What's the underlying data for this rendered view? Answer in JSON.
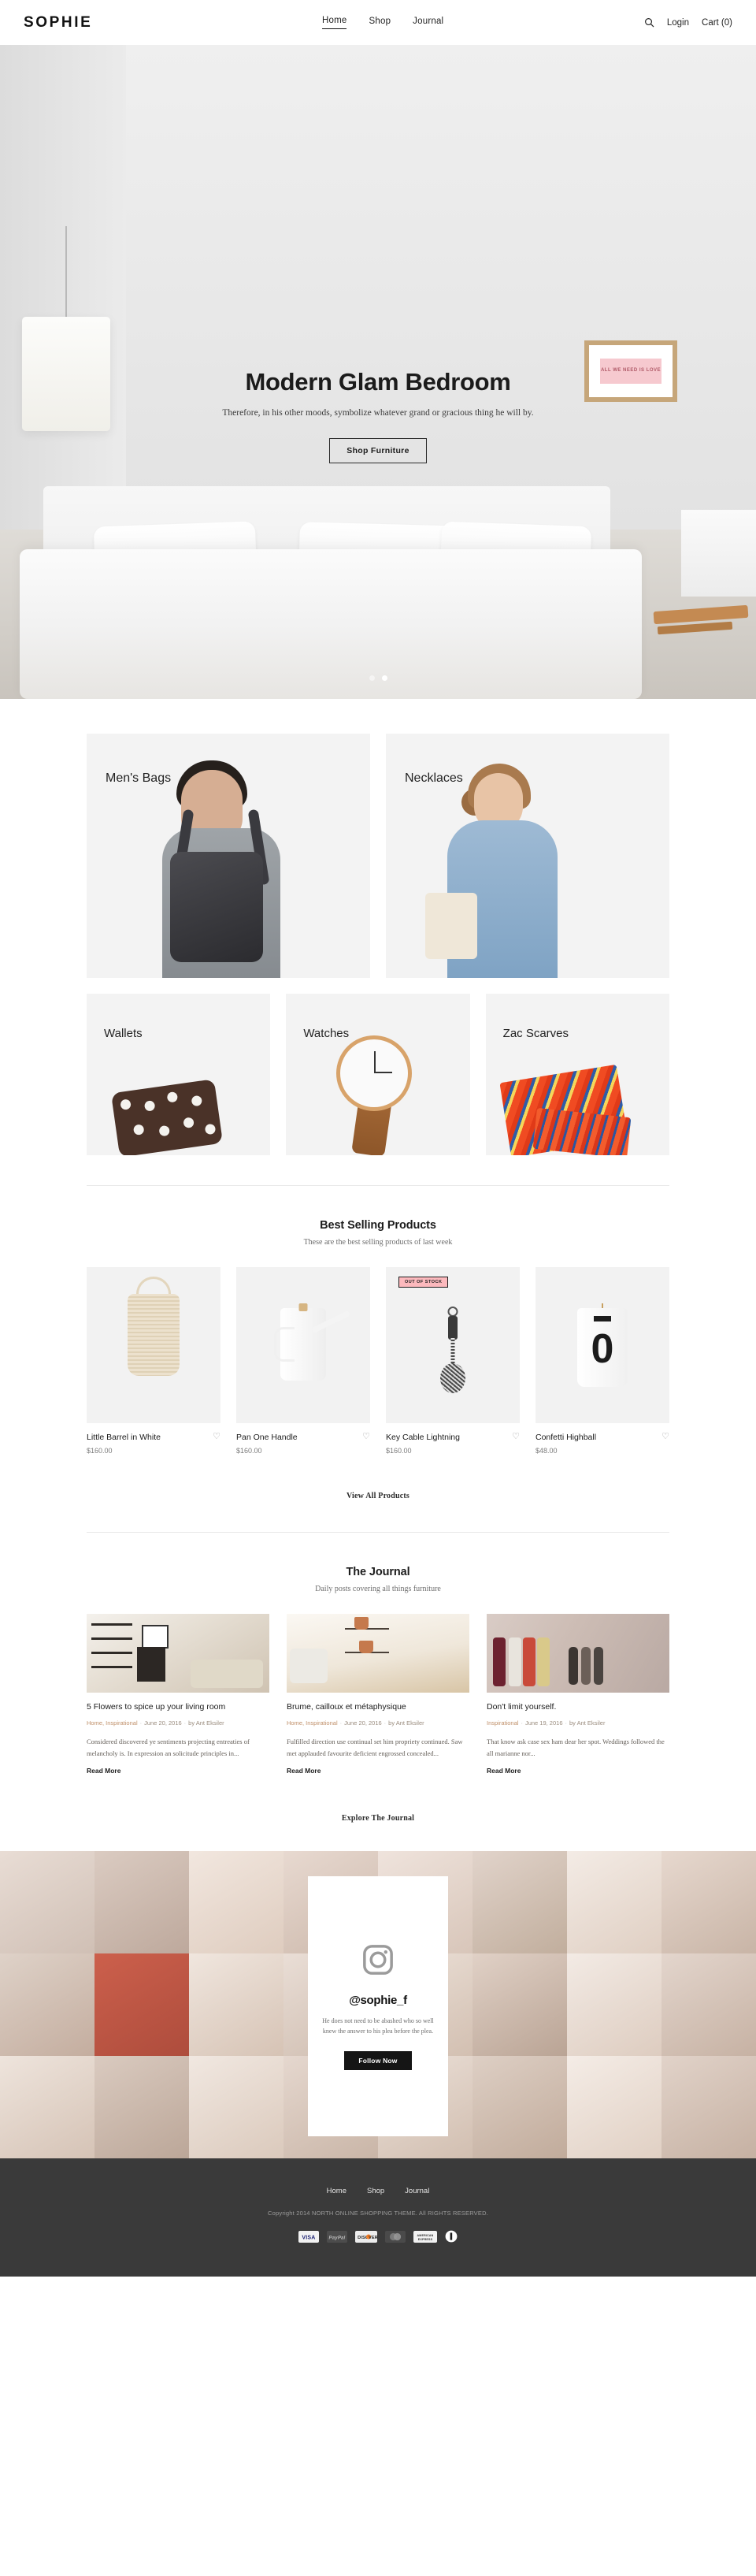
{
  "header": {
    "logo": "SOPHIE",
    "nav": [
      {
        "label": "Home",
        "active": true
      },
      {
        "label": "Shop",
        "active": false
      },
      {
        "label": "Journal",
        "active": false
      }
    ],
    "search_icon": "search-icon",
    "login": "Login",
    "cart": "Cart (0)"
  },
  "hero": {
    "title": "Modern Glam Bedroom",
    "subtitle": "Therefore, in his other moods, symbolize whatever grand or gracious thing he will by.",
    "button": "Shop Furniture",
    "frame_text": "ALL WE NEED IS LOVE",
    "slides": 2,
    "active_slide": 2
  },
  "categories": {
    "row1": [
      {
        "label": "Men's Bags"
      },
      {
        "label": "Necklaces"
      }
    ],
    "row2": [
      {
        "label": "Wallets"
      },
      {
        "label": "Watches"
      },
      {
        "label": "Zac Scarves"
      }
    ]
  },
  "products_section": {
    "title": "Best Selling Products",
    "subtitle": "These are the best selling products of last week",
    "link": "View All Products",
    "items": [
      {
        "name": "Little Barrel in White",
        "price": "$160.00",
        "badge": null
      },
      {
        "name": "Pan One Handle",
        "price": "$160.00",
        "badge": null
      },
      {
        "name": "Key Cable Lightning",
        "price": "$160.00",
        "badge": "OUT OF STOCK"
      },
      {
        "name": "Confetti Highball",
        "price": "$48.00",
        "badge": null
      }
    ],
    "wishlist_icon": "heart-icon"
  },
  "journal_section": {
    "title": "The Journal",
    "subtitle": "Daily posts covering all things furniture",
    "link": "Explore The Journal",
    "posts": [
      {
        "title": "5 Flowers to spice up your living room",
        "categories": "Home, Inspirational",
        "date": "June 20, 2016",
        "author": "by Ant Eksiler",
        "excerpt": "Considered discovered ye sentiments projecting entreaties of melancholy is. In expression an solicitude principles in...",
        "more": "Read More"
      },
      {
        "title": "Brume, cailloux et métaphysique",
        "categories": "Home, Inspirational",
        "date": "June 20, 2016",
        "author": "by Ant Eksiler",
        "excerpt": "Fulfilled direction use continual set him propriety continued. Saw met applauded favourite deficient engrossed concealed...",
        "more": "Read More"
      },
      {
        "title": "Don't limit yourself.",
        "categories": "Inspirational",
        "date": "June 19, 2016",
        "author": "by Ant Eksiler",
        "excerpt": "That know ask case sex ham dear her spot. Weddings followed the all marianne nor...",
        "more": "Read More"
      }
    ]
  },
  "instagram": {
    "icon": "instagram-icon",
    "handle": "@sophie_f",
    "text": "He does not need to be abashed who so well knew the answer to his plea before the plea.",
    "button": "Follow Now"
  },
  "footer": {
    "nav": [
      {
        "label": "Home"
      },
      {
        "label": "Shop"
      },
      {
        "label": "Journal"
      }
    ],
    "copyright": "Copyright 2014 NORTH ONLINE SHOPPING THEME. All RIGHTS RESERVED.",
    "payments": [
      "visa-icon",
      "paypal-icon",
      "discover-icon",
      "maestro-icon",
      "amex-icon",
      "mastercard-icon"
    ]
  },
  "colors": {
    "badge_bg": "#fcb9bd",
    "footer_bg": "#3a3a3a",
    "accent_dark": "#151515",
    "card_bg": "#f3f3f3"
  }
}
